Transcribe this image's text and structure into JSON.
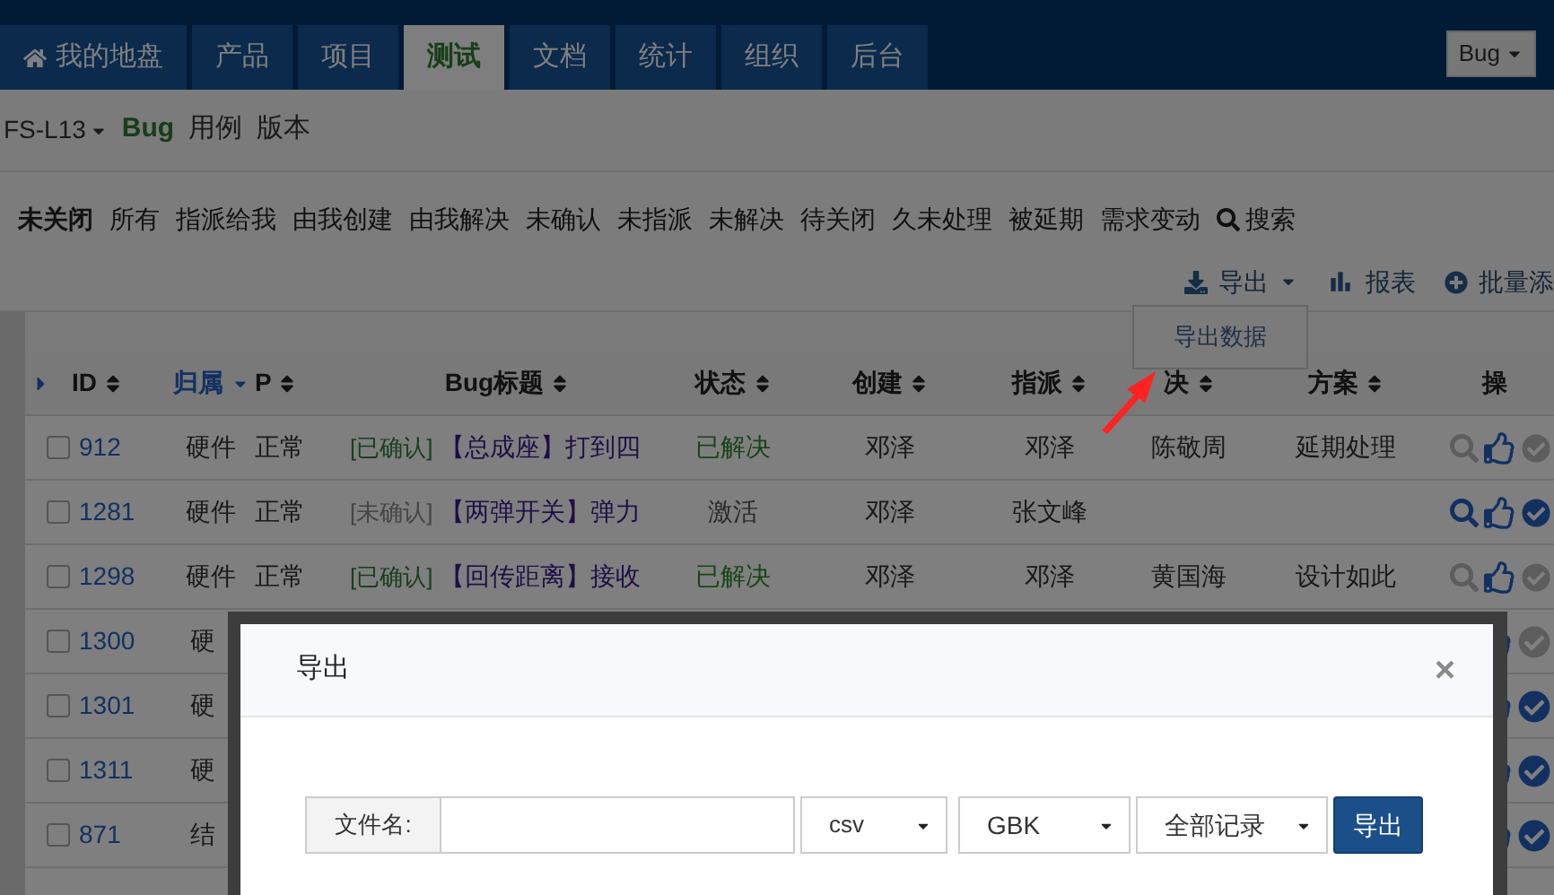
{
  "nav": {
    "tabs": [
      {
        "label": "我的地盘",
        "kind": "home",
        "selected": false
      },
      {
        "label": "产品",
        "selected": false
      },
      {
        "label": "项目",
        "selected": false
      },
      {
        "label": "测试",
        "selected": true
      },
      {
        "label": "文档",
        "selected": false
      },
      {
        "label": "统计",
        "selected": false
      },
      {
        "label": "组织",
        "selected": false
      },
      {
        "label": "后台",
        "selected": false
      }
    ],
    "search_type": "Bug"
  },
  "subnav": {
    "product": "FS-L13",
    "items": [
      {
        "label": "Bug",
        "selected": true
      },
      {
        "label": "用例",
        "selected": false
      },
      {
        "label": "版本",
        "selected": false
      }
    ]
  },
  "filters": [
    {
      "label": "未关闭",
      "selected": true
    },
    {
      "label": "所有",
      "selected": false
    },
    {
      "label": "指派给我",
      "selected": false
    },
    {
      "label": "由我创建",
      "selected": false
    },
    {
      "label": "由我解决",
      "selected": false
    },
    {
      "label": "未确认",
      "selected": false
    },
    {
      "label": "未指派",
      "selected": false
    },
    {
      "label": "未解决",
      "selected": false
    },
    {
      "label": "待关闭",
      "selected": false
    },
    {
      "label": "久未处理",
      "selected": false
    },
    {
      "label": "被延期",
      "selected": false
    },
    {
      "label": "需求变动",
      "selected": false
    }
  ],
  "search_label": "搜索",
  "actions": [
    {
      "label": "导出",
      "kind": "export"
    },
    {
      "label": "报表",
      "kind": "report"
    },
    {
      "label": "批量添",
      "kind": "batch"
    }
  ],
  "export_menu": {
    "items": [
      "导出数据"
    ]
  },
  "table": {
    "columns": [
      {
        "label": "ID",
        "sorted": false
      },
      {
        "label": "归属",
        "sorted": true
      },
      {
        "label": "P",
        "sorted": false
      },
      {
        "label": "Bug标题",
        "sorted": false
      },
      {
        "label": "状态",
        "sorted": false
      },
      {
        "label": "创建",
        "sorted": false
      },
      {
        "label": "指派",
        "sorted": false
      },
      {
        "label": "决",
        "sorted": false
      },
      {
        "label": "方案",
        "sorted": false
      },
      {
        "label": "操",
        "sorted": false
      }
    ],
    "rows": [
      {
        "id": "912",
        "owner": "硬件",
        "priority": "正常",
        "confirm": "[已确认]",
        "confirmed": true,
        "title": "【总成座】打到四",
        "status": "已解决",
        "resolved": true,
        "creator": "邓泽",
        "assignee": "邓泽",
        "resolver": "陈敬周",
        "resolution": "延期处理",
        "checked": false,
        "icons": [
          {
            "kind": "search",
            "enabled": false
          },
          {
            "kind": "thumb",
            "enabled": true
          },
          {
            "kind": "check",
            "enabled": false
          }
        ]
      },
      {
        "id": "1281",
        "owner": "硬件",
        "priority": "正常",
        "confirm": "[未确认]",
        "confirmed": false,
        "title": "【两弹开关】弹力",
        "status": "激活",
        "resolved": false,
        "creator": "邓泽",
        "assignee": "张文峰",
        "checked": false,
        "icons": [
          {
            "kind": "search",
            "enabled": true
          },
          {
            "kind": "thumb",
            "enabled": true
          },
          {
            "kind": "check",
            "enabled": true
          }
        ]
      },
      {
        "id": "1298",
        "owner": "硬件",
        "priority": "正常",
        "confirm": "[已确认]",
        "confirmed": true,
        "title": "【回传距离】接收",
        "status": "已解决",
        "resolved": true,
        "creator": "邓泽",
        "assignee": "邓泽",
        "resolver": "黄国海",
        "resolution": "设计如此",
        "checked": false,
        "icons": [
          {
            "kind": "search",
            "enabled": false
          },
          {
            "kind": "thumb",
            "enabled": true
          },
          {
            "kind": "check",
            "enabled": false
          }
        ]
      },
      {
        "id": "1300",
        "owner": "硬",
        "checked": false,
        "icons": [
          {
            "kind": "thumb",
            "enabled": true
          },
          {
            "kind": "check",
            "enabled": false
          }
        ]
      },
      {
        "id": "1301",
        "owner": "硬",
        "checked": false,
        "icons": [
          {
            "kind": "thumb",
            "enabled": true
          },
          {
            "kind": "check",
            "enabled": true
          }
        ]
      },
      {
        "id": "1311",
        "owner": "硬",
        "checked": false,
        "icons": [
          {
            "kind": "thumb",
            "enabled": true
          },
          {
            "kind": "check",
            "enabled": true
          }
        ]
      },
      {
        "id": "871",
        "owner": "结",
        "checked": false,
        "icons": [
          {
            "kind": "thumb",
            "enabled": true
          },
          {
            "kind": "check",
            "enabled": true
          }
        ]
      }
    ]
  },
  "dialog": {
    "title": "导出",
    "close": "×",
    "filename_label": "文件名:",
    "format": "csv",
    "encoding": "GBK",
    "scope": "全部记录",
    "submit": "导出"
  }
}
